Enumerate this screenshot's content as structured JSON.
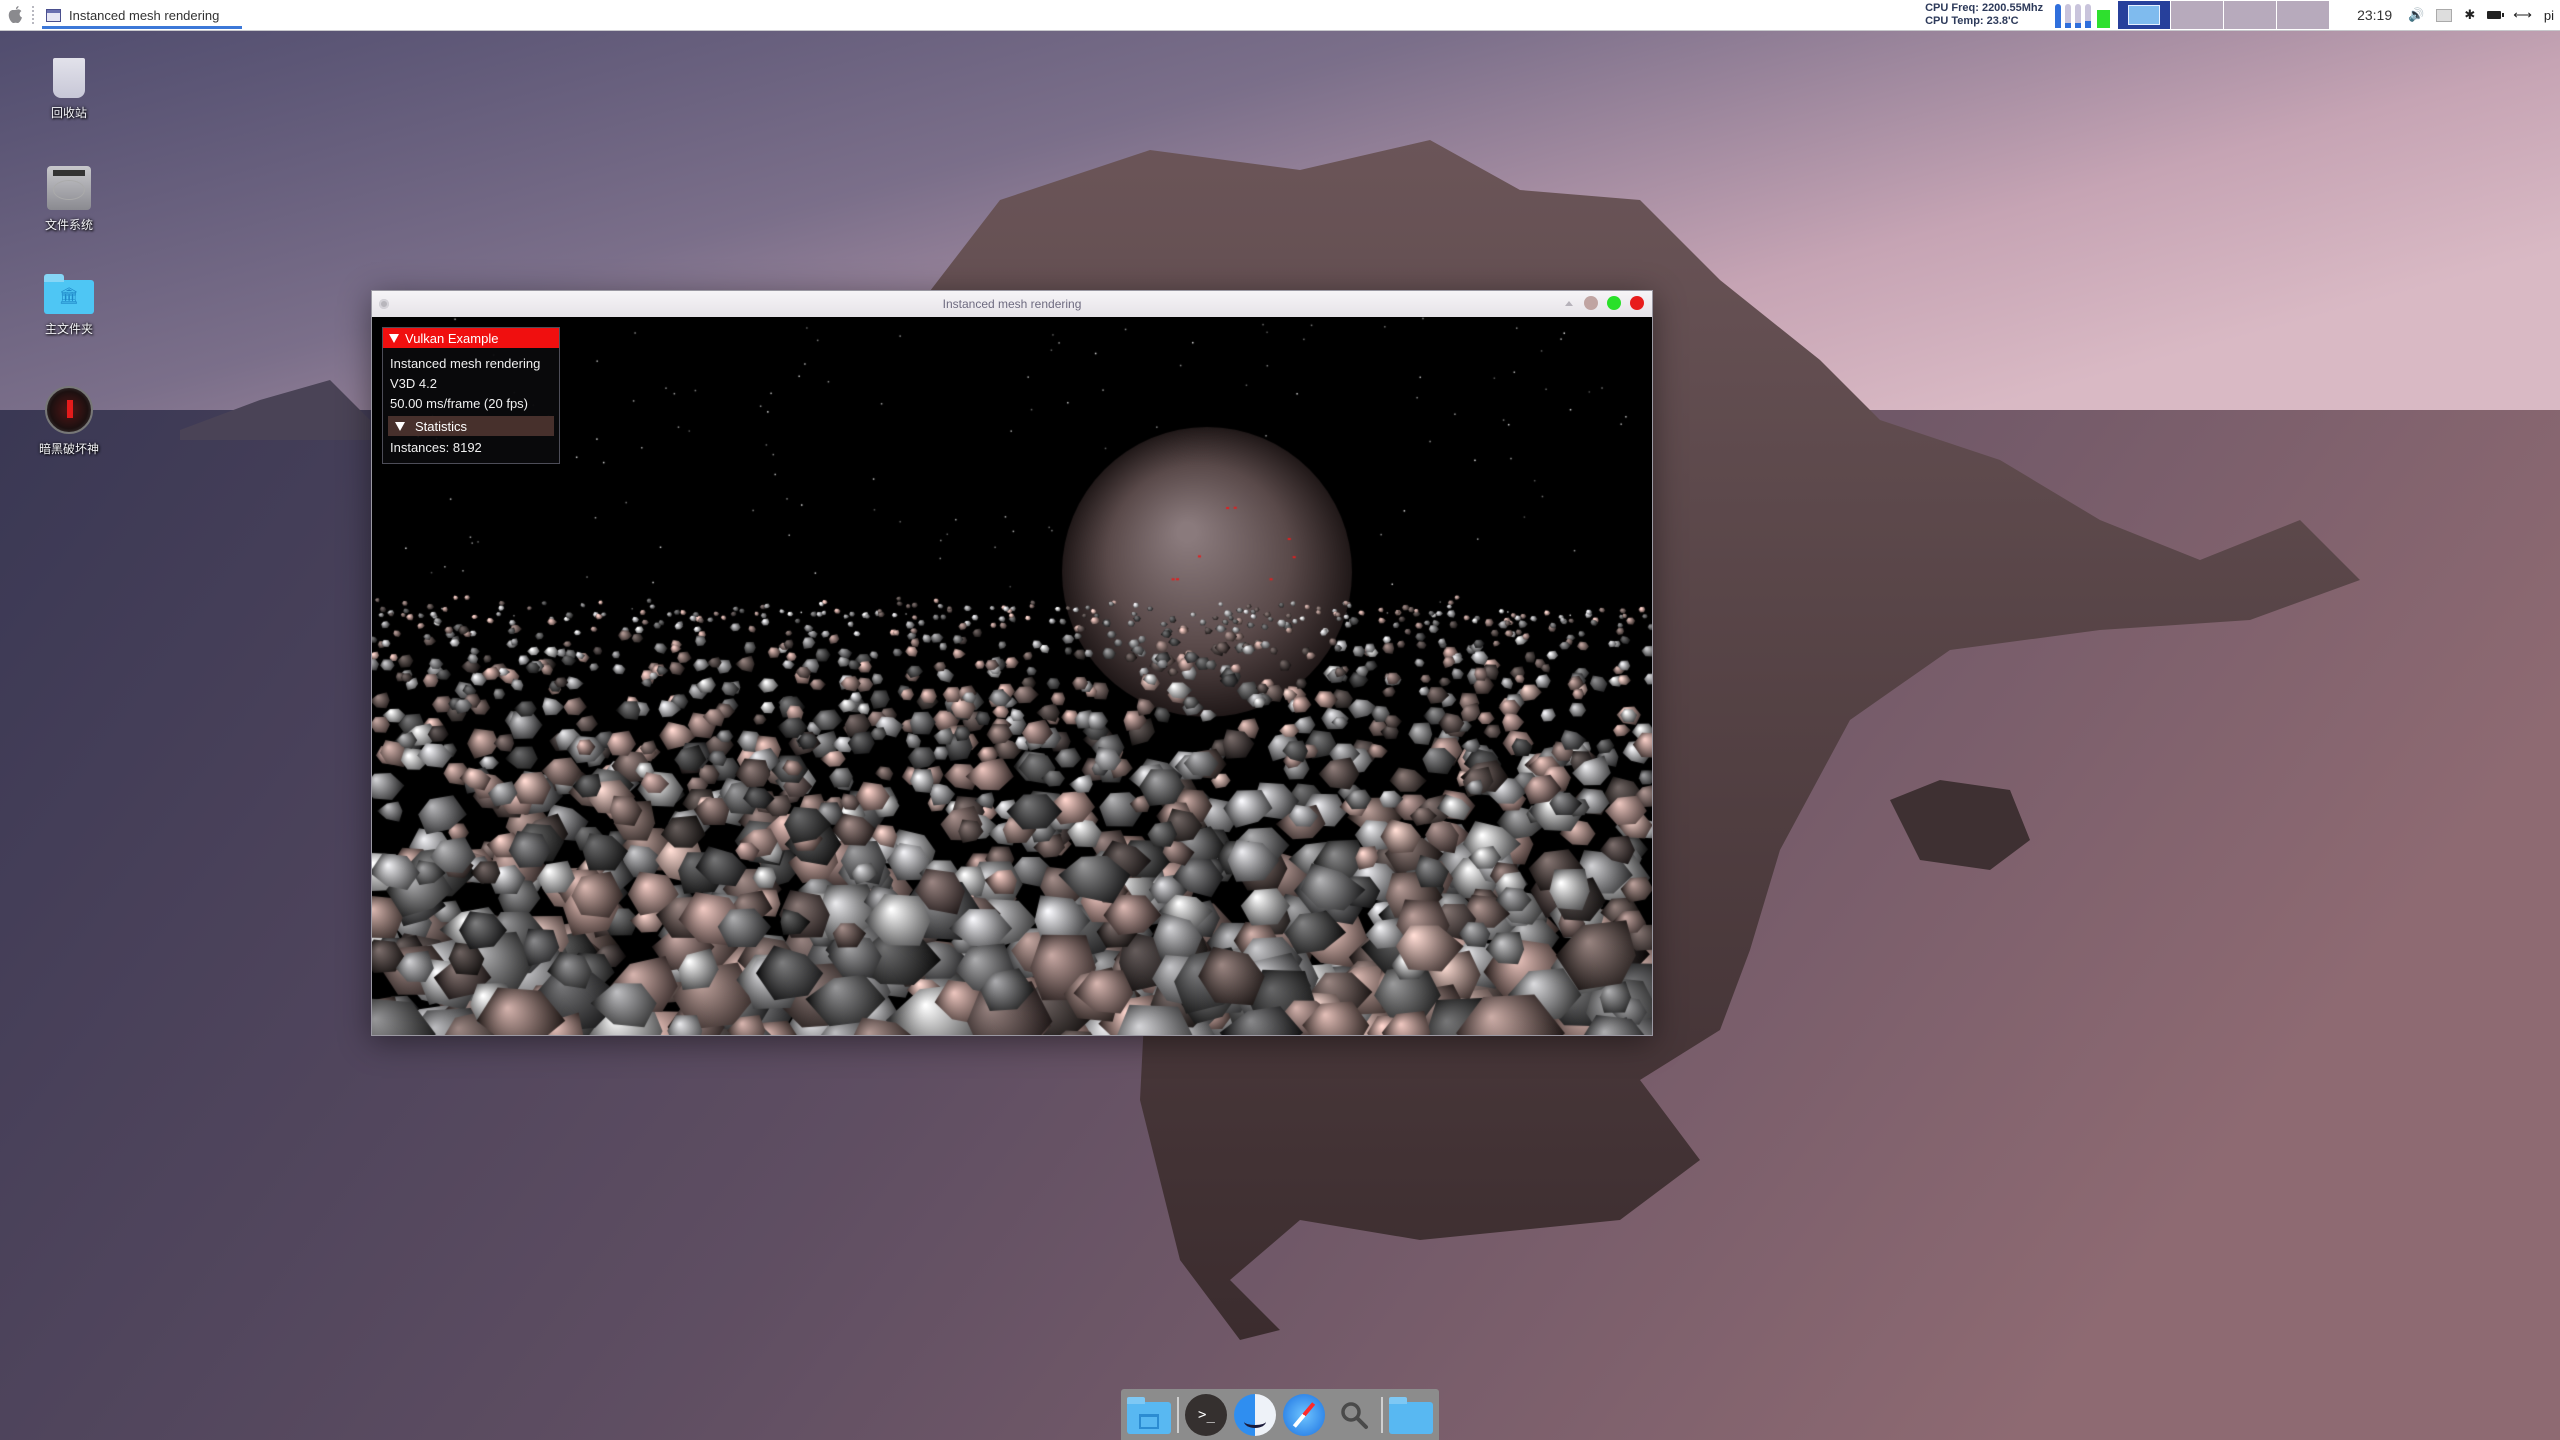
{
  "top_panel": {
    "active_window_title": "Instanced mesh rendering",
    "cpu_freq": "CPU Freq: 2200.55Mhz",
    "cpu_temp": "CPU Temp: 23.8'C",
    "cpu_cores_usage": [
      1.0,
      0.2,
      0.2,
      0.3
    ],
    "memory_usage": 0.7,
    "workspaces": [
      {
        "name": "workspace-1",
        "active": true
      },
      {
        "name": "workspace-2",
        "active": false
      },
      {
        "name": "workspace-3",
        "active": false
      },
      {
        "name": "workspace-4",
        "active": false
      }
    ],
    "clock": "23:19",
    "tray": {
      "volume_icon": "volume-icon",
      "keyboard_icon": "keyboard-icon",
      "bluetooth_icon": "bluetooth-icon",
      "battery_icon": "battery-icon",
      "network_icon": "network-icon",
      "user": "pi"
    }
  },
  "desktop_icons": [
    {
      "label": "回收站",
      "icon": "trash-icon"
    },
    {
      "label": "文件系统",
      "icon": "hard-drive-icon"
    },
    {
      "label": "主文件夹",
      "icon": "home-folder-icon"
    },
    {
      "label": "暗黑破坏神",
      "icon": "diablo-game-icon"
    }
  ],
  "window": {
    "title": "Instanced mesh rendering",
    "controls": [
      "shade",
      "minimize",
      "maximize",
      "close"
    ],
    "colors": {
      "minimize": "#c0a4a2",
      "maximize": "#29e029",
      "close": "#e81c1c"
    },
    "overlay": {
      "header": "Vulkan Example",
      "lines": [
        "Instanced mesh rendering",
        "V3D 4.2",
        "50.00 ms/frame (20 fps)"
      ],
      "section": "Statistics",
      "stats": "Instances: 8192",
      "header_color": "#f00f0f"
    }
  },
  "dock": {
    "items": [
      {
        "name": "file-manager",
        "icon": "drawer-folder-icon"
      },
      {
        "name": "terminal",
        "icon": "terminal-icon",
        "glyph": ">_"
      },
      {
        "name": "finder",
        "icon": "finder-icon"
      },
      {
        "name": "safari",
        "icon": "safari-compass-icon"
      },
      {
        "name": "search",
        "icon": "search-icon",
        "glyph": "🔍"
      },
      {
        "name": "folder",
        "icon": "folder-icon"
      }
    ]
  }
}
